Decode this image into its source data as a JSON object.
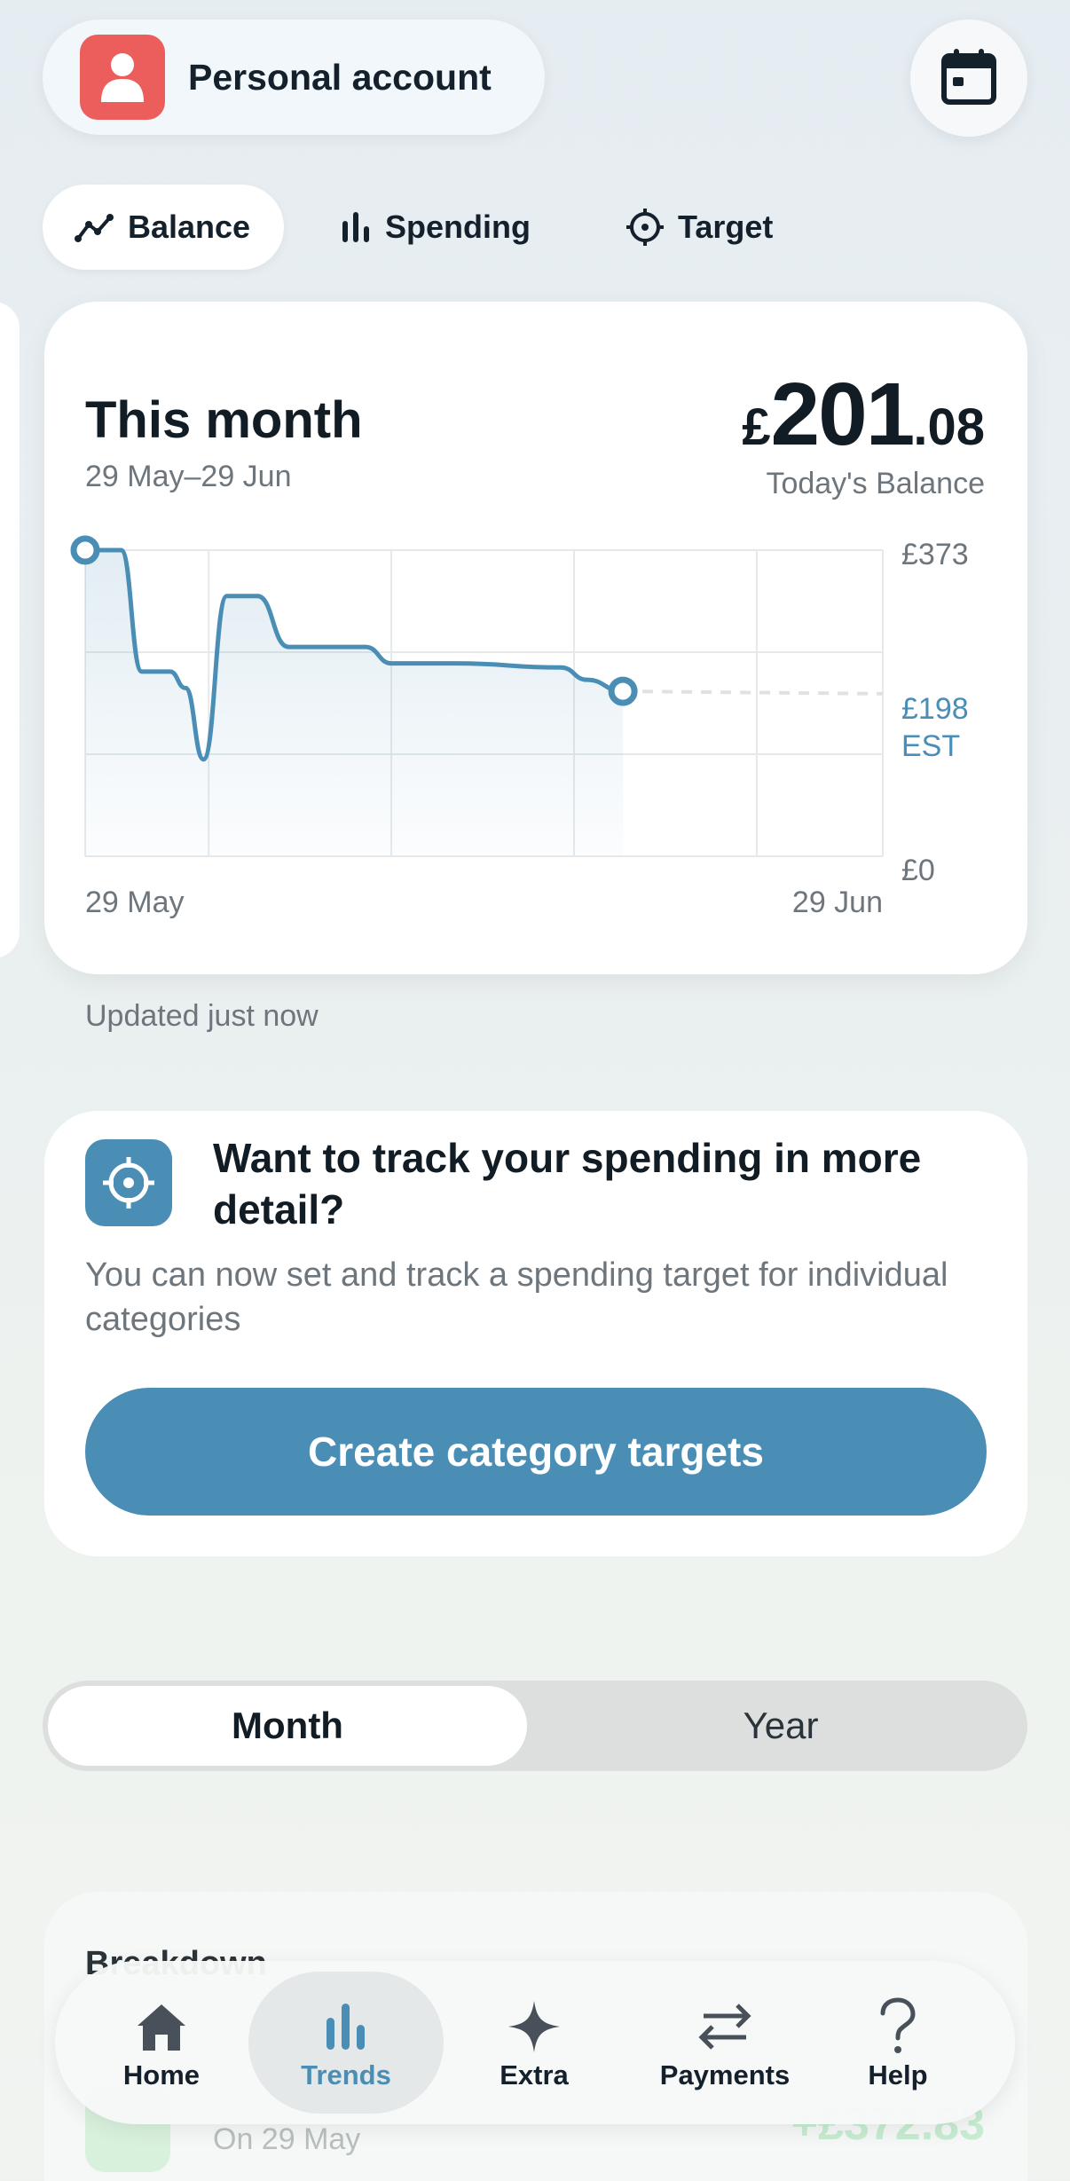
{
  "header": {
    "account_label": "Personal account",
    "avatar_icon": "person-icon",
    "calendar_icon": "calendar-icon"
  },
  "tabs": [
    {
      "label": "Balance",
      "icon": "trend-line-icon",
      "active": true
    },
    {
      "label": "Spending",
      "icon": "bar-chart-icon",
      "active": false
    },
    {
      "label": "Target",
      "icon": "crosshair-icon",
      "active": false
    }
  ],
  "balance_card": {
    "title": "This month",
    "date_range": "29 May–29 Jun",
    "currency": "£",
    "amount_whole": "201",
    "amount_fraction": ".08",
    "amount_caption": "Today's Balance"
  },
  "chart_data": {
    "type": "line",
    "title": "This month",
    "x_labels": [
      "29 May",
      "29 Jun"
    ],
    "y_tick_labels": [
      "£373",
      "£0"
    ],
    "estimate_label": [
      "£198",
      "EST"
    ],
    "ylim": [
      0,
      373
    ],
    "xlim": [
      0,
      31
    ],
    "grid": true,
    "series": [
      {
        "values_x": [
          0,
          1.4,
          2.2,
          3.3,
          3.9,
          4.6,
          5.5,
          6.7,
          7.9,
          8.9,
          10.9,
          11.9,
          13.0,
          13.6,
          14.4,
          18.5,
          19.5,
          20.9
        ],
        "values_y": [
          373,
          373,
          225,
          225,
          205,
          118,
          317,
          317,
          255,
          255,
          255,
          235,
          235,
          235,
          235,
          230,
          215,
          201
        ]
      }
    ],
    "estimate": {
      "from_x": 20.9,
      "from_y": 201,
      "to_x": 31,
      "to_y": 198,
      "style": "dashed"
    },
    "accent": "#4a8eb6"
  },
  "status": {
    "updated": "Updated just now"
  },
  "promo": {
    "icon": "crosshair-icon",
    "title": "Want to track your spending in more detail?",
    "body": "You can now set and track a spending target for individual categories",
    "button_label": "Create category targets"
  },
  "period_toggle": {
    "options": [
      "Month",
      "Year"
    ],
    "selected": "Month"
  },
  "breakdown": {
    "title": "Breakdown",
    "date": "On 29 May",
    "amount": "+£372.83"
  },
  "nav": [
    {
      "label": "Home",
      "icon": "home-icon",
      "active": false
    },
    {
      "label": "Trends",
      "icon": "bar-chart-icon",
      "active": true
    },
    {
      "label": "Extra",
      "icon": "sparkle-icon",
      "active": false
    },
    {
      "label": "Payments",
      "icon": "transfer-arrows-icon",
      "active": false
    },
    {
      "label": "Help",
      "icon": "question-mark-icon",
      "active": false
    }
  ],
  "colors": {
    "accent": "#4a8eb6",
    "avatar": "#ec5e5c",
    "text_primary": "#121c25",
    "text_secondary": "#6e767d"
  }
}
